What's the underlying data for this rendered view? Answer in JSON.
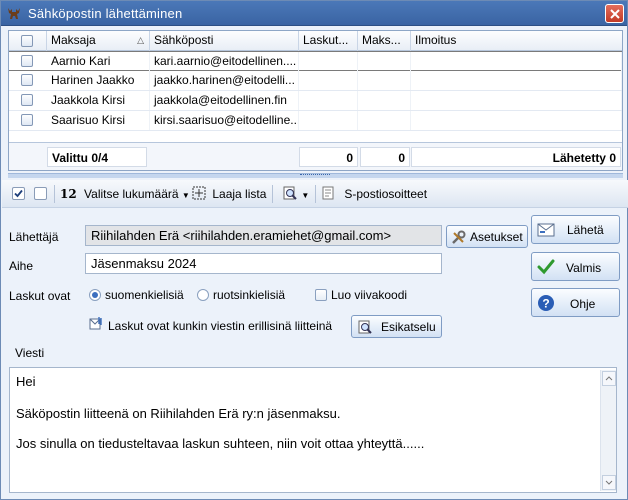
{
  "window": {
    "title": "Sähköpostin lähettäminen"
  },
  "grid": {
    "columns": [
      "Maksaja",
      "Sähköposti",
      "Laskut...",
      "Maks...",
      "Ilmoitus"
    ],
    "rows": [
      {
        "maksaja": "Aarnio Kari",
        "email": "kari.aarnio@eitodellinen....",
        "laskut": "",
        "maks": "",
        "ilmoitus": ""
      },
      {
        "maksaja": "Harinen Jaakko",
        "email": "jaakko.harinen@eitodelli...",
        "laskut": "",
        "maks": "",
        "ilmoitus": ""
      },
      {
        "maksaja": "Jaakkola Kirsi",
        "email": "jaakkola@eitodellinen.fin",
        "laskut": "",
        "maks": "",
        "ilmoitus": ""
      },
      {
        "maksaja": "Saarisuo Kirsi",
        "email": "kirsi.saarisuo@eitodelline...",
        "laskut": "",
        "maks": "",
        "ilmoitus": ""
      }
    ],
    "footer": {
      "selected": "Valittu 0/4",
      "laskut_total": "0",
      "maks_total": "0",
      "sent": "Lähetetty 0"
    }
  },
  "toolbar": {
    "count_number": "12",
    "count_label": "Valitse lukumäärä",
    "expand_label": "Laaja lista",
    "addresses_label": "S-postiosoitteet"
  },
  "form": {
    "sender_label": "Lähettäjä",
    "sender_value": "Riihilahden Erä <riihilahden.eramiehet@gmail.com>",
    "settings_button": "Asetukset",
    "subject_label": "Aihe",
    "subject_value": "Jäsenmaksu 2024",
    "lang_label": "Laskut ovat",
    "lang_fi": "suomenkielisiä",
    "lang_sv": "ruotsinkielisiä",
    "barcode_label": "Luo viivakoodi",
    "attach_label": "Laskut ovat kunkin viestin erillisinä liitteinä",
    "preview_button": "Esikatselu",
    "message_label": "Viesti"
  },
  "side_buttons": {
    "send": "Lähetä",
    "done": "Valmis",
    "help": "Ohje"
  },
  "message": {
    "lines": [
      "Hei",
      "Säköpostin liitteenä on Riihilahden Erä ry:n jäsenmaksu.",
      "Jos sinulla on tiedusteltavaa laskun suhteen, niin voit ottaa yhteyttä......"
    ]
  }
}
